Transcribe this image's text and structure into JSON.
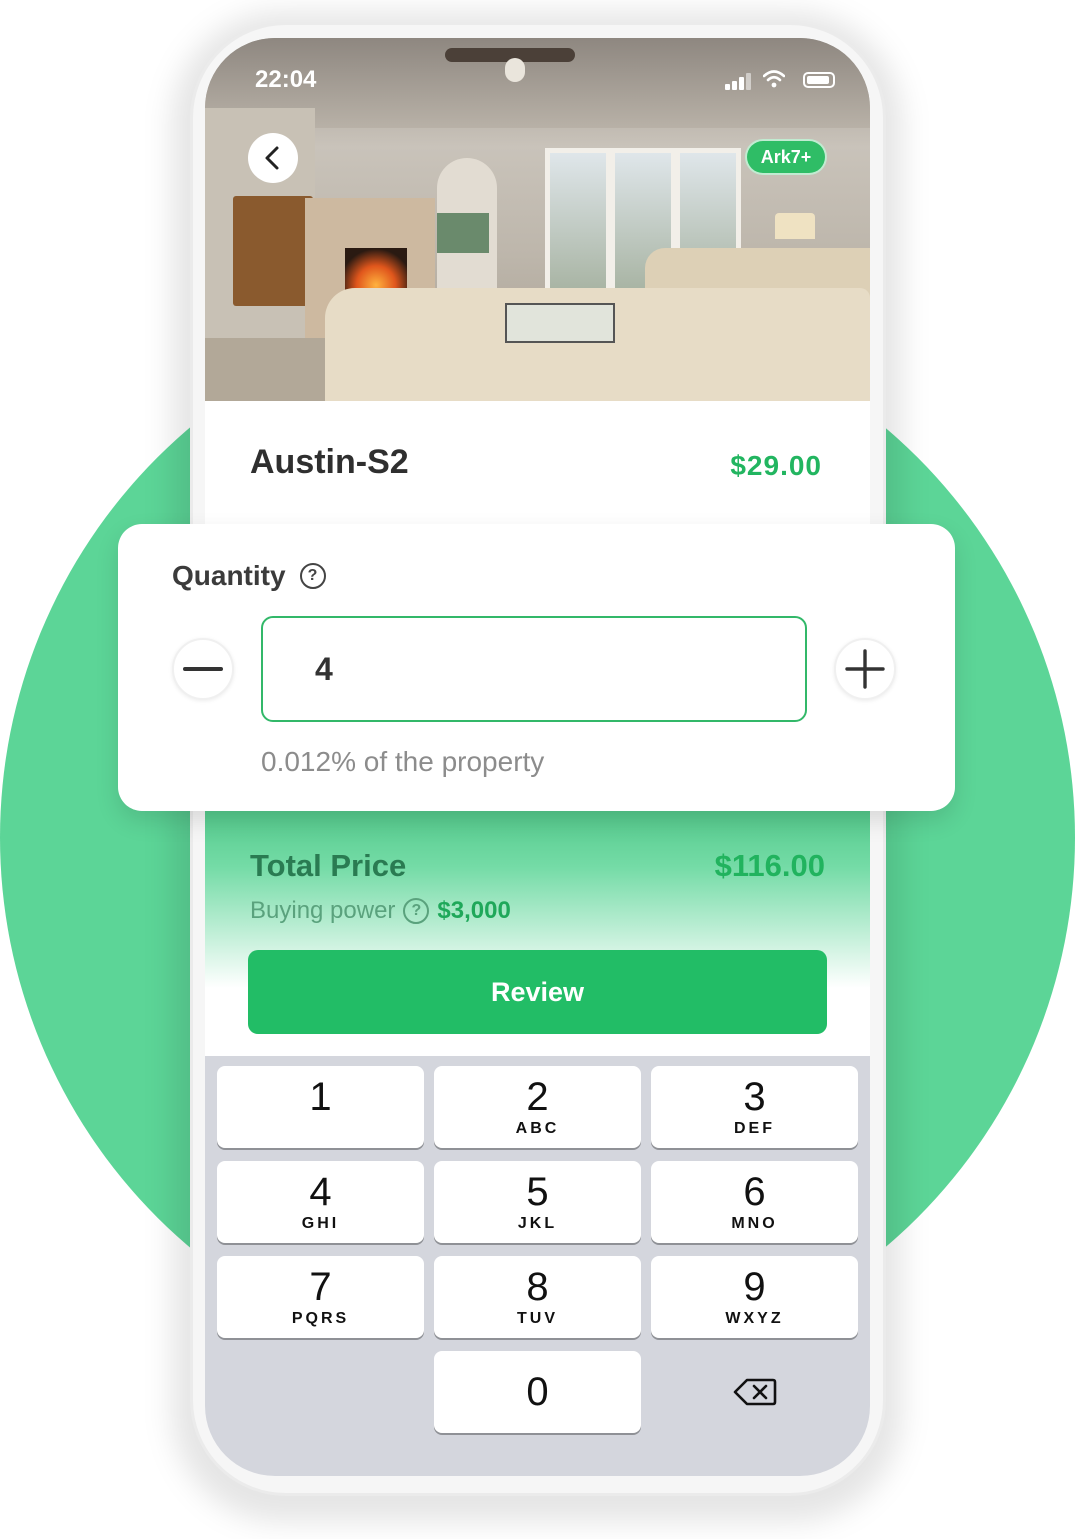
{
  "status": {
    "time": "22:04"
  },
  "photo": {
    "tag": "Ark7+"
  },
  "property": {
    "name": "Austin-S2",
    "price": "$29.00"
  },
  "quantity": {
    "title": "Quantity",
    "help_icon": "question-circle-icon",
    "value": "4",
    "ownership": "0.012% of the property"
  },
  "total": {
    "label": "Total Price",
    "value": "$116.00",
    "buying_power_label": "Buying power",
    "buying_power_value": "$3,000"
  },
  "review": {
    "label": "Review"
  },
  "keypad": {
    "keys": [
      {
        "digit": "1",
        "letters": ""
      },
      {
        "digit": "2",
        "letters": "ABC"
      },
      {
        "digit": "3",
        "letters": "DEF"
      },
      {
        "digit": "4",
        "letters": "GHI"
      },
      {
        "digit": "5",
        "letters": "JKL"
      },
      {
        "digit": "6",
        "letters": "MNO"
      },
      {
        "digit": "7",
        "letters": "PQRS"
      },
      {
        "digit": "8",
        "letters": "TUV"
      },
      {
        "digit": "9",
        "letters": "WXYZ"
      },
      {
        "digit": "0",
        "letters": ""
      }
    ],
    "delete_icon": "backspace-icon"
  },
  "colors": {
    "accent": "#22bd66",
    "background_circle": "#5cd597",
    "price": "#22b560"
  }
}
